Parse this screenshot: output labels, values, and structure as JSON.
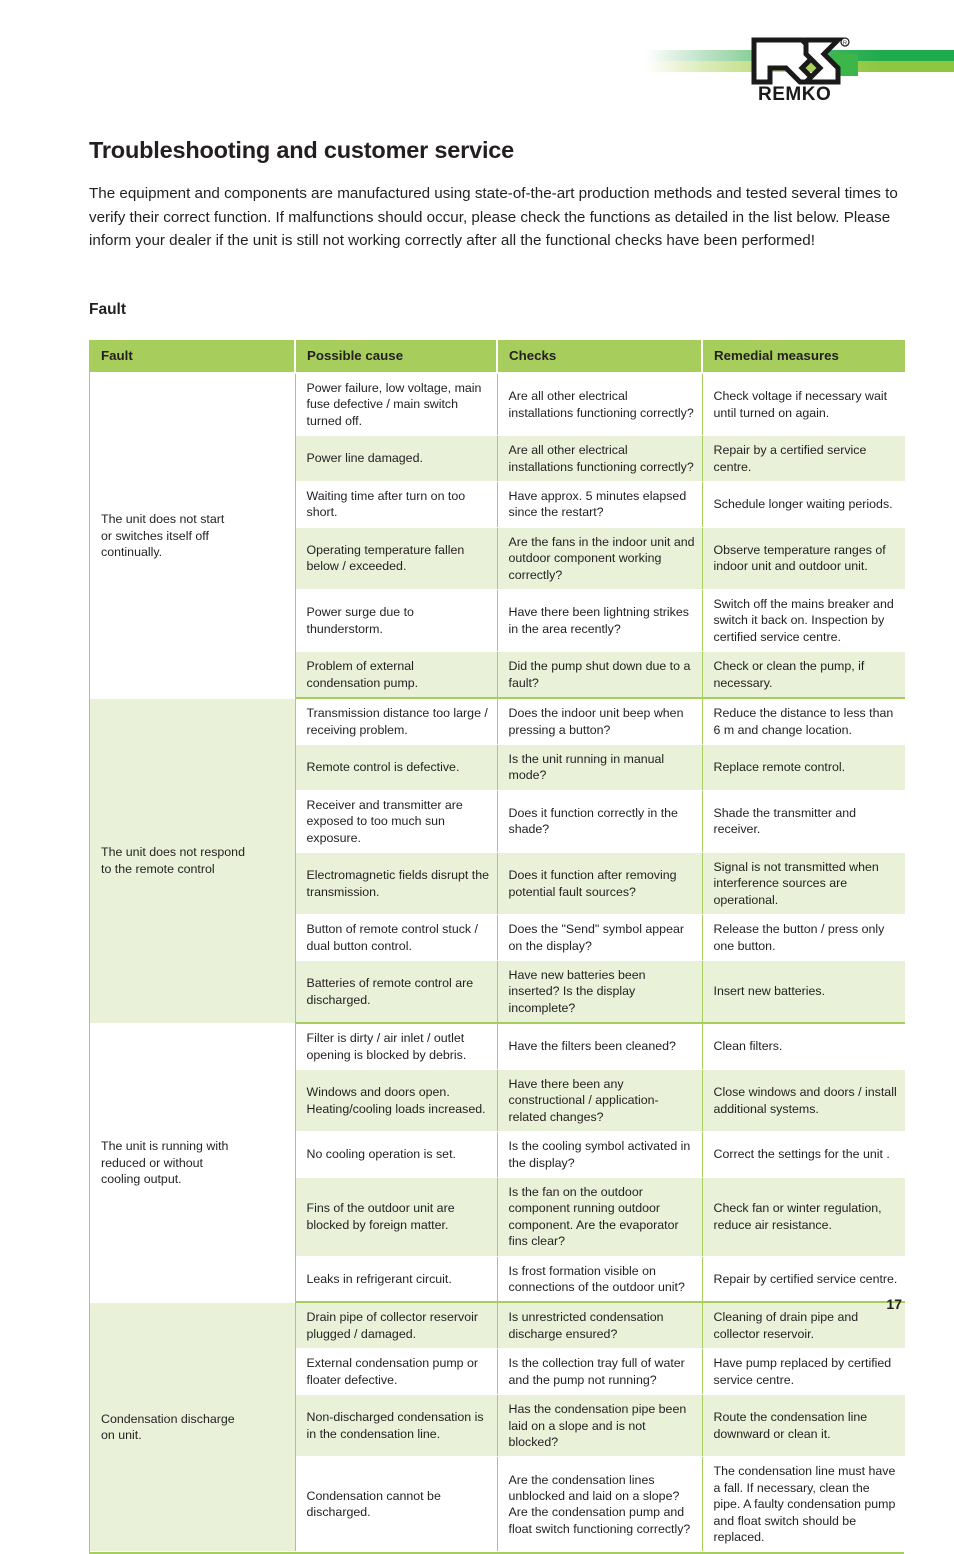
{
  "header": {
    "logo_wordmark": "REMKO",
    "logo_trademark": "®",
    "accent_green_dark": "#1faa4b",
    "accent_green_light": "#8dc63f"
  },
  "page_title": "Troubleshooting and customer service",
  "intro": "The equipment and components are manufactured using state-of-the-art production methods and tested several times to verify their correct function. If malfunctions should occur, please check the functions as detailed in the list below. Please inform your dealer if the unit is still not working correctly after all the functional checks have been performed!",
  "section_title": "Fault",
  "table": {
    "header_bg": "#a7ce5c",
    "row_alt_bg": "#e9f1d8",
    "columns": [
      "Fault",
      "Possible cause",
      "Checks",
      "Remedial measures"
    ],
    "groups": [
      {
        "fault": "The unit does not start\nor switches itself off\ncontinually.",
        "fault_shaded": false,
        "rows": [
          {
            "cause": "Power failure, low voltage, main fuse defective / main switch turned off.",
            "check": "Are all other electrical installations functioning correctly?",
            "remedy": "Check voltage if necessary wait until turned on again.",
            "alt": false
          },
          {
            "cause": "Power line damaged.",
            "check": "Are all other electrical installations functioning correctly?",
            "remedy": "Repair by a certified service centre.",
            "alt": true
          },
          {
            "cause": "Waiting time after turn on too short.",
            "check": "Have approx. 5 minutes elapsed since the restart?",
            "remedy": "Schedule longer waiting periods.",
            "alt": false
          },
          {
            "cause": "Operating temperature fallen below / exceeded.",
            "check": "Are the fans in the indoor unit and outdoor component working correctly?",
            "remedy": "Observe temperature ranges of indoor unit and outdoor unit.",
            "alt": true
          },
          {
            "cause": "Power surge due to thunderstorm.",
            "check": "Have there been lightning strikes in the area recently?",
            "remedy": "Switch off the mains breaker and switch it back on. Inspection by certified service centre.",
            "alt": false
          },
          {
            "cause": "Problem of external condensation pump.",
            "check": "Did the pump shut down due to a fault?",
            "remedy": "Check or clean the pump, if necessary.",
            "alt": true
          }
        ]
      },
      {
        "fault": "The unit does not respond\nto the remote control",
        "fault_shaded": true,
        "rows": [
          {
            "cause": "Transmission distance too large / receiving problem.",
            "check": "Does the indoor unit beep when pressing a button?",
            "remedy": "Reduce the distance to less than 6 m and change location.",
            "alt": false
          },
          {
            "cause": "Remote control is defective.",
            "check": "Is the unit running in manual mode?",
            "remedy": "Replace remote control.",
            "alt": true
          },
          {
            "cause": "Receiver and transmitter are exposed to too much sun exposure.",
            "check": "Does it function correctly in the shade?",
            "remedy": "Shade the transmitter and receiver.",
            "alt": false
          },
          {
            "cause": "Electromagnetic fields disrupt the transmission.",
            "check": "Does it function after removing potential fault sources?",
            "remedy": "Signal is not transmitted when interference sources are operational.",
            "alt": true
          },
          {
            "cause": "Button of remote control stuck / dual button control.",
            "check": "Does the \"Send\" symbol appear on the display?",
            "remedy": "Release the button / press only one button.",
            "alt": false
          },
          {
            "cause": "Batteries of remote control are discharged.",
            "check": "Have new batteries been inserted? Is the display incomplete?",
            "remedy": "Insert new batteries.",
            "alt": true
          }
        ]
      },
      {
        "fault": "The unit is running with\nreduced or without\ncooling output.",
        "fault_shaded": false,
        "rows": [
          {
            "cause": "Filter is dirty / air inlet / outlet opening is blocked by debris.",
            "check": "Have the filters been cleaned?",
            "remedy": "Clean filters.",
            "alt": false
          },
          {
            "cause": "Windows and doors open. Heating/cooling loads increased.",
            "check": "Have there been any constructional / application-related changes?",
            "remedy": "Close windows and doors  / install additional systems.",
            "alt": true
          },
          {
            "cause": "No cooling operation is set.",
            "check": "Is the cooling symbol activated in the display?",
            "remedy": "Correct the settings for the unit .",
            "alt": false
          },
          {
            "cause": "Fins of the outdoor unit are blocked by foreign matter.",
            "check": "Is the fan on the outdoor component running outdoor component. Are the evaporator fins clear?",
            "remedy": "Check fan or winter regulation, reduce air resistance.",
            "alt": true
          },
          {
            "cause": "Leaks in refrigerant circuit.",
            "check": "Is frost formation visible on connections of the outdoor unit?",
            "remedy": "Repair by certified service centre.",
            "alt": false
          }
        ]
      },
      {
        "fault": "Condensation discharge\non unit.",
        "fault_shaded": true,
        "rows": [
          {
            "cause": "Drain pipe of collector reservoir plugged / damaged.",
            "check": "Is unrestricted condensation discharge ensured?",
            "remedy": "Cleaning of drain pipe and collector reservoir.",
            "alt": true
          },
          {
            "cause": "External condensation pump or floater defective.",
            "check": "Is the collection tray full of water and the pump not running?",
            "remedy": "Have pump replaced by certified service centre.",
            "alt": false
          },
          {
            "cause": "Non-discharged condensation is in the condensation line.",
            "check": "Has the condensation pipe been laid on a slope and is not blocked?",
            "remedy": "Route the condensation line downward or clean it.",
            "alt": true
          },
          {
            "cause": "Condensation cannot be discharged.",
            "check": "Are the condensation lines unblocked and laid on a slope? Are the condensation pump and float switch functioning correctly?",
            "remedy": "The condensation line must have a fall. If necessary, clean the pipe. A faulty condensation pump and float switch should be replaced.",
            "alt": false
          }
        ]
      }
    ]
  },
  "page_number": "17"
}
